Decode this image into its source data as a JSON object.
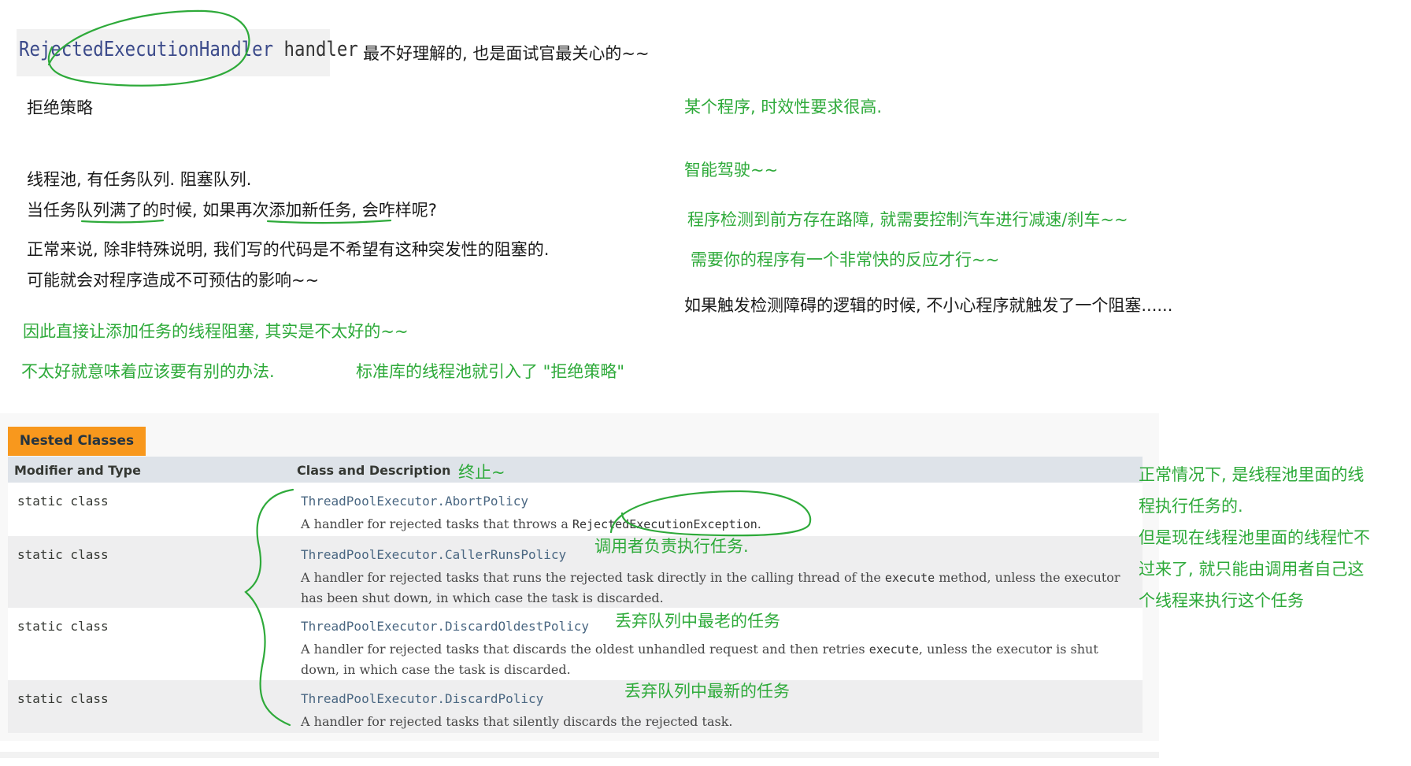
{
  "code_header": {
    "class_name": "RejectedExecutionHandler",
    "field_name": "handler"
  },
  "notes": {
    "hardest": "最不好理解的, 也是面试官最关心的~~",
    "rejection_policy": "拒绝策略",
    "line_queue": "线程池, 有任务队列. 阻塞队列.",
    "line_full": "当任务队列满了的时候, 如果再次添加新任务, 会咋样呢?",
    "line_normal": "正常来说, 除非特殊说明, 我们写的代码是不希望有这种突发性的阻塞的.",
    "line_impact": "可能就会对程序造成不可预估的影响~~",
    "green_block": "因此直接让添加任务的线程阻塞, 其实是不太好的~~",
    "green_other": "不太好就意味着应该要有别的办法.",
    "green_std": "标准库的线程池就引入了 \"拒绝策略\"",
    "right_1": "某个程序, 时效性要求很高.",
    "right_2": "智能驾驶~~",
    "right_3": "程序检测到前方存在路障, 就需要控制汽车进行减速/刹车~~",
    "right_4": "需要你的程序有一个非常快的反应才行~~",
    "right_5": "如果触发检测障碍的逻辑的时候, 不小心程序就触发了一个阻塞......",
    "side_1": "正常情况下, 是线程池里面的线",
    "side_2": "程执行任务的.",
    "side_3": "但是现在线程池里面的线程忙不",
    "side_4": "过来了, 就只能由调用者自己这",
    "side_5": "个线程来执行这个任务",
    "abort_note": "终止~",
    "caller_note": "调用者负责执行任务.",
    "oldest_note": "丢弃队列中最老的任务",
    "discard_note": "丢弃队列中最新的任务"
  },
  "javadoc": {
    "tab_label": "Nested Classes",
    "col_modifier": "Modifier and Type",
    "col_class": "Class and Description",
    "rows": [
      {
        "modifier": "static class",
        "name": "ThreadPoolExecutor.AbortPolicy",
        "desc_pre": "A handler for rejected tasks that throws a ",
        "desc_code": "RejectedExecutionException",
        "desc_post": "."
      },
      {
        "modifier": "static class",
        "name": "ThreadPoolExecutor.CallerRunsPolicy",
        "desc_pre": "A handler for rejected tasks that runs the rejected task directly in the calling thread of the ",
        "desc_code": "execute",
        "desc_post": " method, unless the executor has been shut down, in which case the task is discarded."
      },
      {
        "modifier": "static class",
        "name": "ThreadPoolExecutor.DiscardOldestPolicy",
        "desc_pre": "A handler for rejected tasks that discards the oldest unhandled request and then retries ",
        "desc_code": "execute",
        "desc_post": ", unless the executor is shut down, in which case the task is discarded."
      },
      {
        "modifier": "static class",
        "name": "ThreadPoolExecutor.DiscardPolicy",
        "desc_pre": "A handler for rejected tasks that silently discards the rejected task.",
        "desc_code": "",
        "desc_post": ""
      }
    ]
  },
  "colors": {
    "annotation_green": "#2eaa3a",
    "tab_orange": "#f8981d",
    "header_blue_gray": "#dee3e9",
    "link_blue": "#4a6782"
  }
}
